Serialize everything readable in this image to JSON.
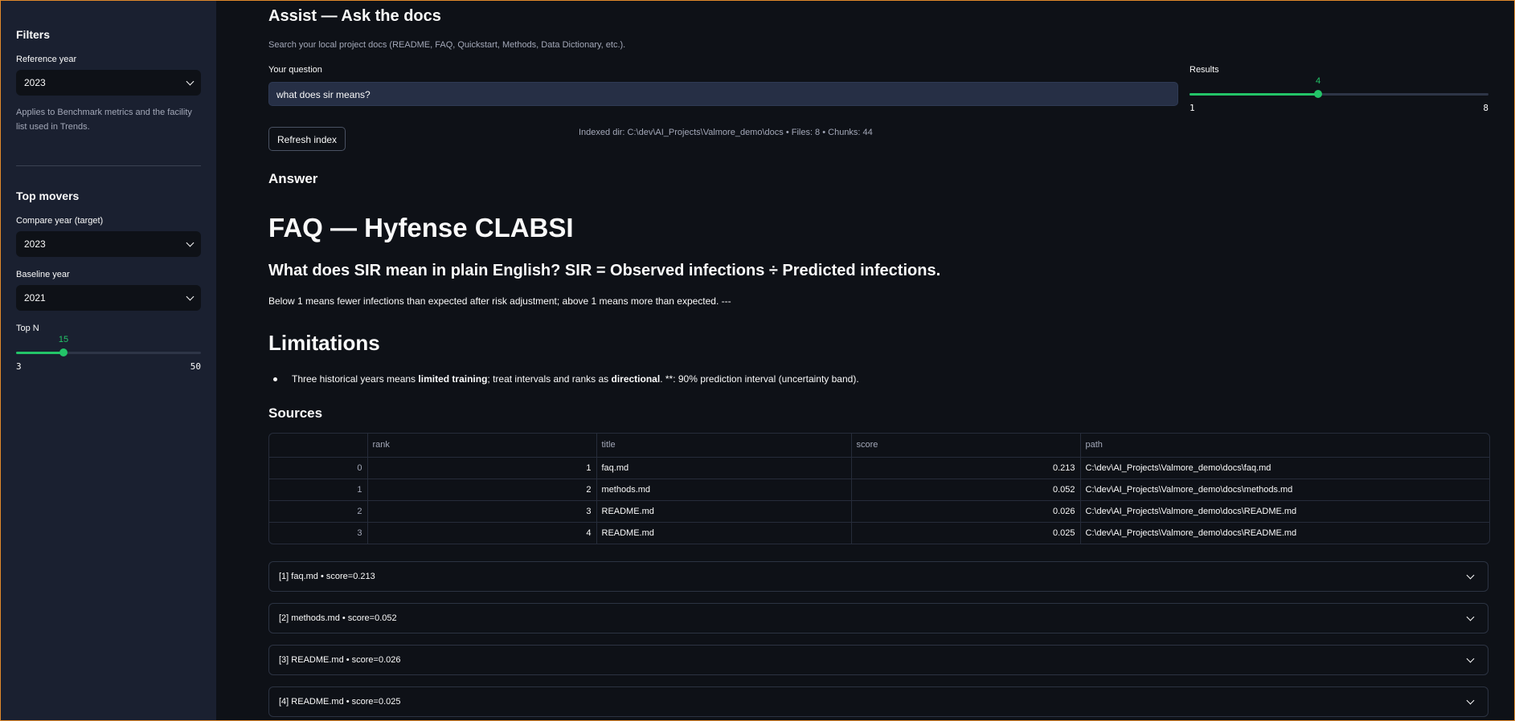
{
  "sidebar": {
    "filters_heading": "Filters",
    "reference_year_label": "Reference year",
    "reference_year_value": "2023",
    "reference_help": "Applies to Benchmark metrics and the facility list used in Trends.",
    "top_movers_heading": "Top movers",
    "compare_year_label": "Compare year (target)",
    "compare_year_value": "2023",
    "baseline_year_label": "Baseline year",
    "baseline_year_value": "2021",
    "topn_label": "Top N",
    "topn_value": "15",
    "topn_min": "3",
    "topn_max": "50",
    "topn_fraction": 0.255
  },
  "main": {
    "title": "Assist — Ask the docs",
    "subtitle": "Search your local project docs (README, FAQ, Quickstart, Methods, Data Dictionary, etc.).",
    "question_label": "Your question",
    "question_value": "what does sir means?",
    "results_label": "Results",
    "results_value": "4",
    "results_min": "1",
    "results_max": "8",
    "results_fraction": 0.43,
    "refresh_button": "Refresh index",
    "index_info": "Indexed dir: C:\\dev\\AI_Projects\\Valmore_demo\\docs • Files: 8 • Chunks: 44",
    "answer_heading": "Answer",
    "answer_h1": "FAQ — Hyfense CLABSI",
    "answer_h2": "What does SIR mean in plain English? SIR = Observed infections ÷ Predicted infections.",
    "answer_para": "Below 1 means fewer infections than expected after risk adjustment; above 1 means more than expected. ---",
    "limitations_heading": "Limitations",
    "bullet_pre": "Three historical years means ",
    "bullet_bold1": "limited training",
    "bullet_mid": "; treat intervals and ranks as ",
    "bullet_bold2": "directional",
    "bullet_post": ". **: 90% prediction interval (uncertainty band).",
    "sources_heading": "Sources",
    "table": {
      "columns": [
        "",
        "rank",
        "title",
        "score",
        "path"
      ],
      "rows": [
        {
          "index": "0",
          "rank": "1",
          "title": "faq.md",
          "score": "0.213",
          "path": "C:\\dev\\AI_Projects\\Valmore_demo\\docs\\faq.md"
        },
        {
          "index": "1",
          "rank": "2",
          "title": "methods.md",
          "score": "0.052",
          "path": "C:\\dev\\AI_Projects\\Valmore_demo\\docs\\methods.md"
        },
        {
          "index": "2",
          "rank": "3",
          "title": "README.md",
          "score": "0.026",
          "path": "C:\\dev\\AI_Projects\\Valmore_demo\\docs\\README.md"
        },
        {
          "index": "3",
          "rank": "4",
          "title": "README.md",
          "score": "0.025",
          "path": "C:\\dev\\AI_Projects\\Valmore_demo\\docs\\README.md"
        }
      ]
    },
    "expanders": [
      "[1] faq.md • score=0.213",
      "[2] methods.md • score=0.052",
      "[3] README.md • score=0.026",
      "[4] README.md • score=0.025"
    ]
  },
  "colors": {
    "accent": "#23c468",
    "background": "#0e1117",
    "sidebar": "#1a2030",
    "frame": "#e0892b"
  }
}
